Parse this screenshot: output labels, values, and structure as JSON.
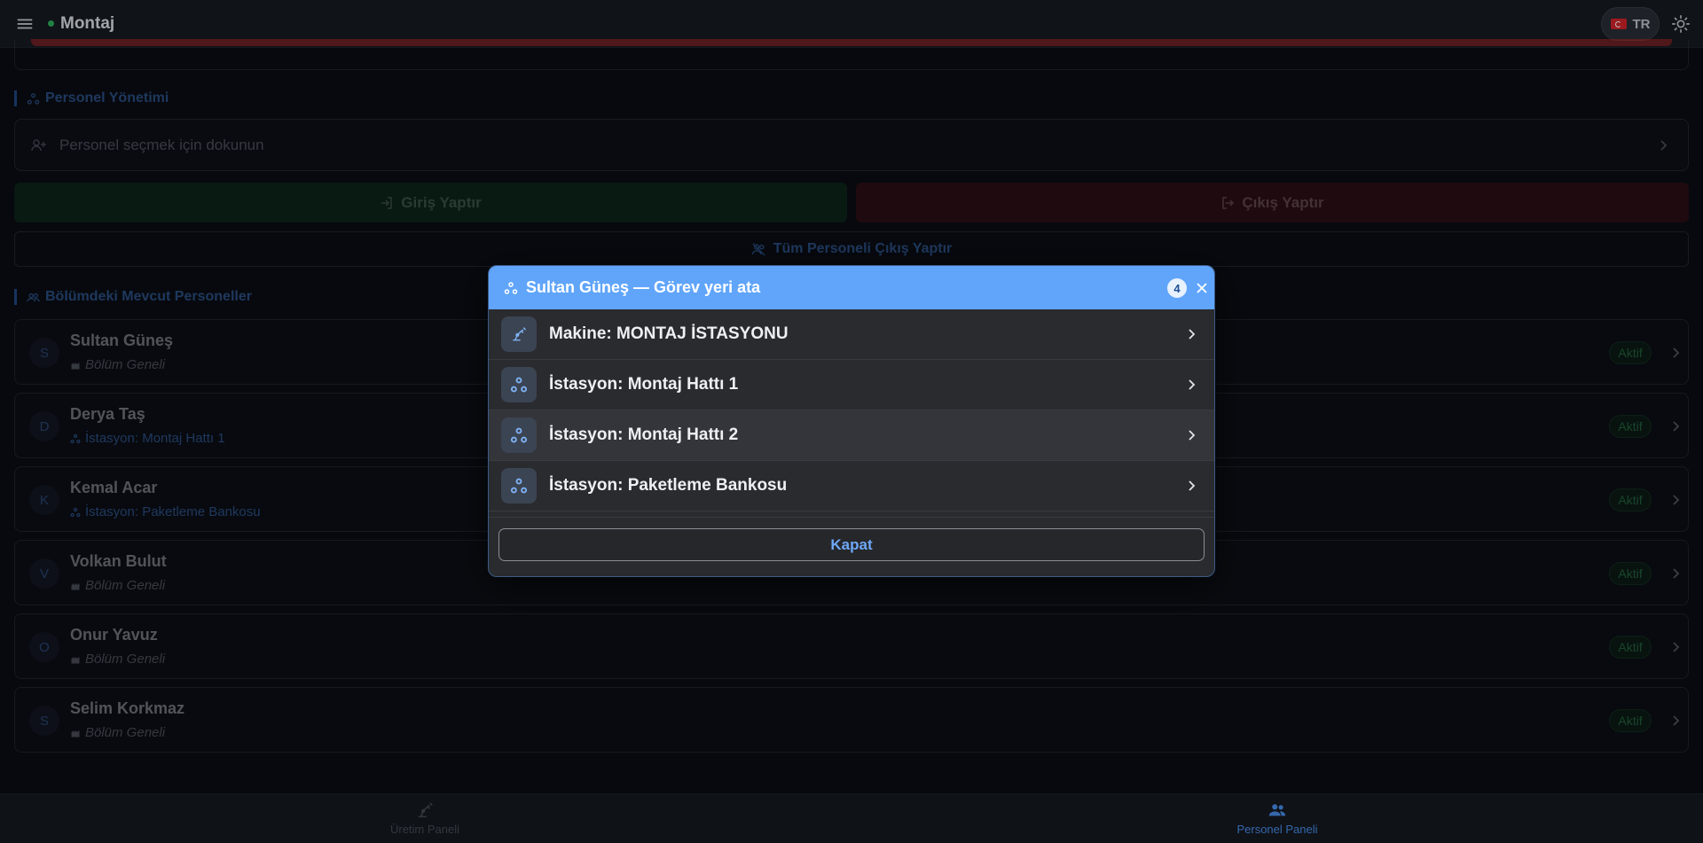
{
  "topbar": {
    "title": "Montaj",
    "language": "TR",
    "menu_icon": "hamburger-menu-icon",
    "theme_icon": "sun-icon"
  },
  "personnel_management": {
    "section_title": "Personel Yönetimi",
    "select_placeholder": "Personel seçmek için dokunun",
    "checkin_label": "Giriş Yaptır",
    "checkout_label": "Çıkış Yaptır",
    "checkout_all_label": "Tüm Personeli Çıkış Yaptır"
  },
  "current_personnel": {
    "section_title": "Bölümdeki Mevcut Personeller",
    "people": [
      {
        "initial": "S",
        "name": "Sultan Güneş",
        "assignment": "Bölüm Geneli",
        "kind": "general",
        "status": "Aktif"
      },
      {
        "initial": "D",
        "name": "Derya Taş",
        "assignment": "İstasyon: Montaj Hattı 1",
        "kind": "station",
        "status": "Aktif"
      },
      {
        "initial": "K",
        "name": "Kemal Acar",
        "assignment": "İstasyon: Paketleme Bankosu",
        "kind": "station",
        "status": "Aktif"
      },
      {
        "initial": "V",
        "name": "Volkan Bulut",
        "assignment": "Bölüm Geneli",
        "kind": "general",
        "status": "Aktif"
      },
      {
        "initial": "O",
        "name": "Onur Yavuz",
        "assignment": "Bölüm Geneli",
        "kind": "general",
        "status": "Aktif"
      },
      {
        "initial": "S",
        "name": "Selim Korkmaz",
        "assignment": "Bölüm Geneli",
        "kind": "general",
        "status": "Aktif"
      }
    ]
  },
  "bottom_nav": {
    "production": "Üretim Paneli",
    "personnel": "Personel Paneli"
  },
  "modal": {
    "title": "Sultan Güneş — Görev yeri ata",
    "count": "4",
    "options": [
      {
        "label": "Makine: MONTAJ İSTASYONU",
        "icon": "robot-arm-icon"
      },
      {
        "label": "İstasyon: Montaj Hattı 1",
        "icon": "station-icon"
      },
      {
        "label": "İstasyon: Montaj Hattı 2",
        "icon": "station-icon"
      },
      {
        "label": "İstasyon: Paketleme Bankosu",
        "icon": "station-icon"
      }
    ],
    "close_label": "Kapat"
  },
  "colors": {
    "accent": "#4a90f0",
    "modal_header": "#60a5fa",
    "success": "#3cb464",
    "danger": "#c92a2a"
  }
}
